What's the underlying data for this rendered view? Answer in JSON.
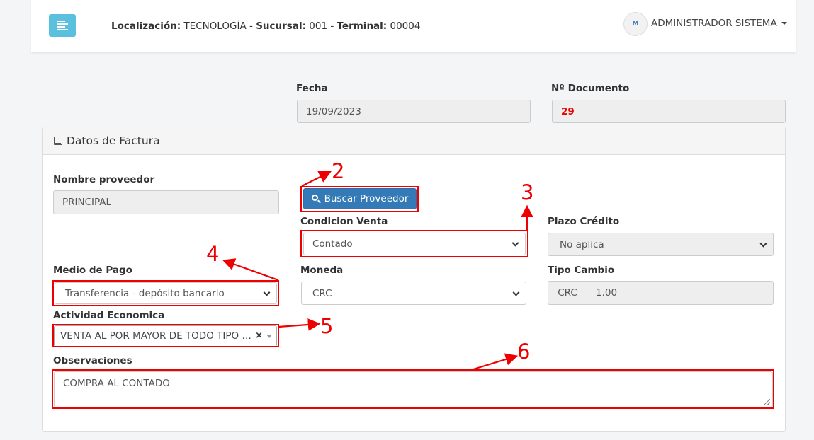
{
  "header": {
    "localizacion_label": "Localización:",
    "localizacion_value": "TECNOLOGÍA",
    "sucursal_label": "Sucursal:",
    "sucursal_value": "001",
    "terminal_label": "Terminal:",
    "terminal_value": "00004",
    "separator": "-",
    "user_name": "ADMINISTRADOR SISTEMA",
    "avatar_text": "M"
  },
  "top_fields": {
    "fecha_label": "Fecha",
    "fecha_value": "19/09/2023",
    "documento_label": "Nº Documento",
    "documento_value": "29"
  },
  "panel": {
    "title": "Datos de Factura",
    "nombre_proveedor_label": "Nombre proveedor",
    "nombre_proveedor_value": "PRINCIPAL",
    "buscar_button": "Buscar Proveedor",
    "condicion_venta_label": "Condicion Venta",
    "condicion_venta_value": "Contado",
    "plazo_credito_label": "Plazo Crédito",
    "plazo_credito_value": "No aplica",
    "medio_pago_label": "Medio de Pago",
    "medio_pago_value": "Transferencia - depósito bancario",
    "moneda_label": "Moneda",
    "moneda_value": "CRC",
    "tipo_cambio_label": "Tipo Cambio",
    "tipo_cambio_currency": "CRC",
    "tipo_cambio_value": "1.00",
    "actividad_label": "Actividad Economica",
    "actividad_value": "VENTA AL POR MAYOR DE TODO TIPO DE …",
    "actividad_clear": "×",
    "observaciones_label": "Observaciones",
    "observaciones_value": "COMPRA AL CONTADO"
  },
  "annotations": {
    "numbers": [
      "2",
      "3",
      "4",
      "5",
      "6"
    ],
    "color": "#e00000"
  },
  "colors": {
    "primary_button": "#337ab7",
    "menu_button": "#5bc0de",
    "highlight": "#e00000"
  }
}
